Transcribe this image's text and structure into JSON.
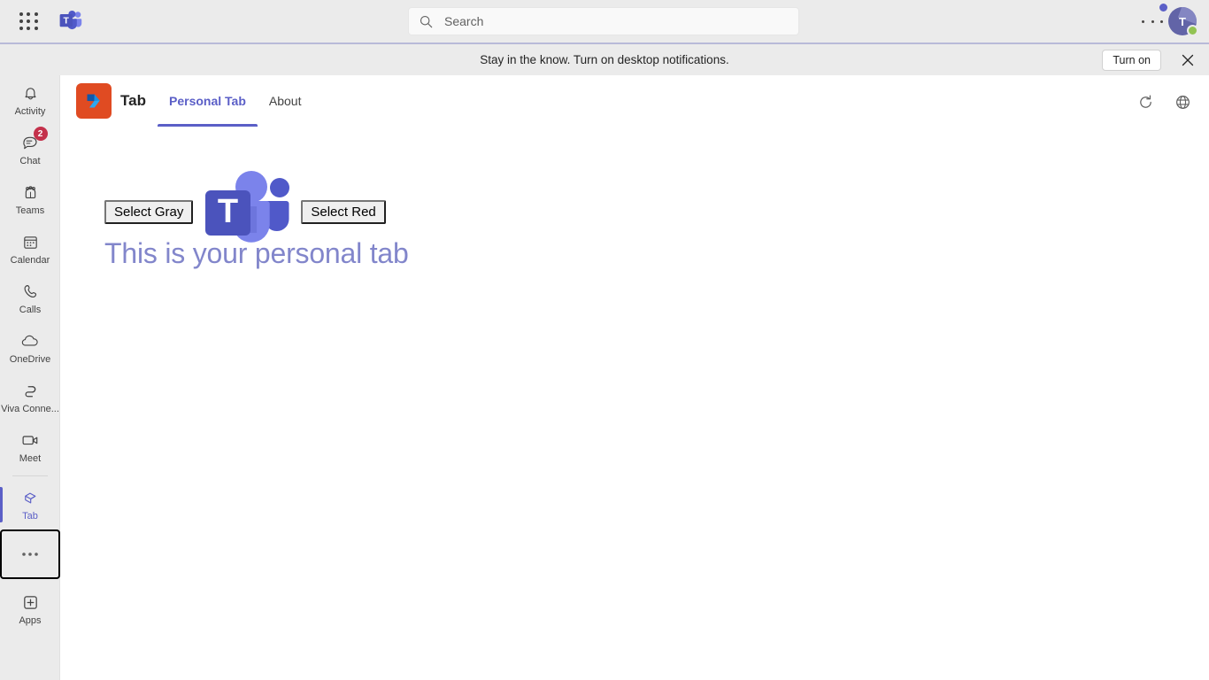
{
  "topbar": {
    "waffle_label": "app-launcher",
    "brand_label": "Microsoft Teams",
    "search": {
      "placeholder": "Search",
      "value": "",
      "icon": "search-icon"
    },
    "more_label": "...",
    "avatar_initial": "T",
    "presence": "available",
    "presence_color": "#92c353"
  },
  "banner": {
    "message": "Stay in the know. Turn on desktop notifications.",
    "turn_on_label": "Turn on",
    "close_label": "✕",
    "accent_color": "#b8bad8"
  },
  "rail": {
    "items": [
      {
        "label": "Activity",
        "icon": "bell-icon",
        "badge": "",
        "active": false
      },
      {
        "label": "Chat",
        "icon": "chat-icon",
        "badge": "2",
        "active": false
      },
      {
        "label": "Teams",
        "icon": "teams-people-icon",
        "badge": "",
        "active": false
      },
      {
        "label": "Calendar",
        "icon": "calendar-icon",
        "badge": "",
        "active": false
      },
      {
        "label": "Calls",
        "icon": "phone-icon",
        "badge": "",
        "active": false
      },
      {
        "label": "OneDrive",
        "icon": "cloud-icon",
        "badge": "",
        "active": false
      },
      {
        "label": "Viva Conne...",
        "icon": "viva-connections-icon",
        "badge": "",
        "active": false
      },
      {
        "label": "Meet",
        "icon": "video-camera-icon",
        "badge": "",
        "active": false
      }
    ],
    "tab_item": {
      "label": "Tab",
      "icon": "tab-app-icon",
      "active": true
    },
    "more_item": {
      "label": "...",
      "icon": "more-horizontal-icon",
      "focused": true
    },
    "apps_item": {
      "label": "Apps",
      "icon": "plus-square-icon"
    },
    "accent_color": "#5b5fc7",
    "badge_color": "#c4314b"
  },
  "app_header": {
    "app_icon_bg": "#e04b22",
    "app_icon_name": "teams-toolkit-icon",
    "title": "Tab",
    "tabs": [
      {
        "label": "Personal Tab",
        "selected": true
      },
      {
        "label": "About",
        "selected": false
      }
    ],
    "actions": [
      {
        "name": "refresh-icon",
        "label": "Refresh"
      },
      {
        "name": "globe-icon",
        "label": "Open in browser"
      }
    ]
  },
  "content": {
    "select_gray_label": "Select Gray",
    "select_red_label": "Select Red",
    "logo_name": "microsoft-teams-logo",
    "headline": "This is your personal tab",
    "headline_color": "#8286cb"
  }
}
